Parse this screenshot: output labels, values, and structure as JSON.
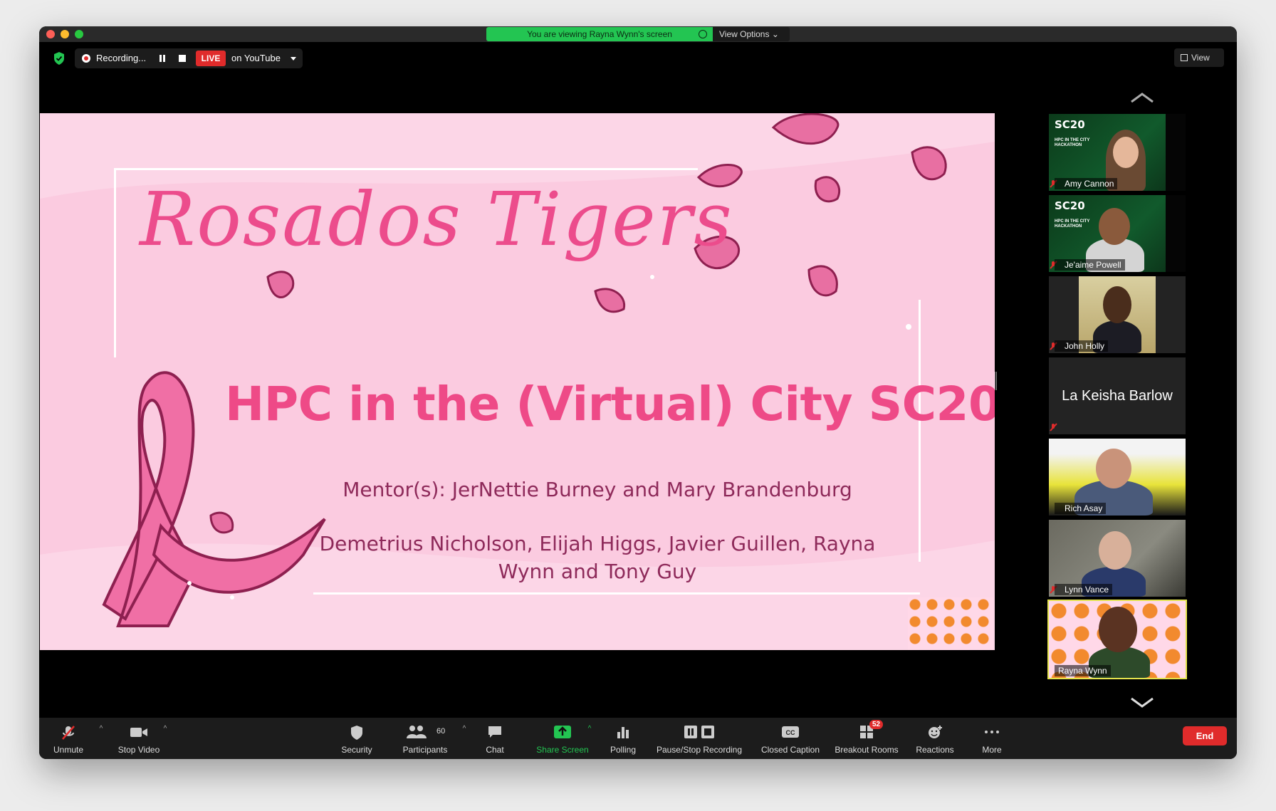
{
  "titlebar": {
    "viewing_text": "You are viewing Rayna Wynn's screen",
    "view_options": "View Options"
  },
  "topbar": {
    "recording_label": "Recording...",
    "live_label": "LIVE",
    "stream_target": "on YouTube",
    "view_label": "View"
  },
  "slide": {
    "team_name": "Rosados Tigers",
    "title": "HPC in the (Virtual) City SC20",
    "mentors": "Mentor(s): JerNettie Burney and Mary  Brandenburg",
    "members_line1": "Demetrius Nicholson, Elijah Higgs, Javier Guillen, Rayna",
    "members_line2": "Wynn and Tony Guy",
    "colors": {
      "background": "#fbcbe0",
      "accent": "#ee4a87",
      "text": "#8e2a5a"
    }
  },
  "gallery": {
    "sc_logo": "SC20",
    "sc_subtitle_line1": "HPC IN THE CITY",
    "sc_subtitle_line2": "HACKATHON",
    "participants": [
      {
        "name": "Amy Cannon",
        "muted": true
      },
      {
        "name": "Je'aime Powell",
        "muted": true
      },
      {
        "name": "John Holly",
        "muted": true
      },
      {
        "name": "La Keisha Barlow",
        "muted": true
      },
      {
        "name": "Rich Asay",
        "muted": false
      },
      {
        "name": "Lynn Vance",
        "muted": true
      },
      {
        "name": "Rayna Wynn",
        "muted": false,
        "active_speaker": true
      }
    ]
  },
  "toolbar": {
    "unmute": "Unmute",
    "stop_video": "Stop Video",
    "security": "Security",
    "participants": "Participants",
    "participants_count": "60",
    "chat": "Chat",
    "share_screen": "Share Screen",
    "polling": "Polling",
    "pause_stop_recording": "Pause/Stop Recording",
    "closed_caption": "Closed Caption",
    "breakout_rooms": "Breakout Rooms",
    "breakout_badge": "52",
    "reactions": "Reactions",
    "more": "More",
    "end": "End",
    "colors": {
      "share_green": "#23c552",
      "end_red": "#e02b2b"
    }
  }
}
